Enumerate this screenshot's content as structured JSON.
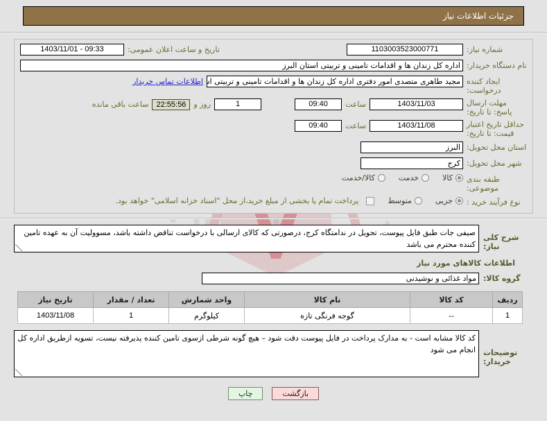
{
  "header": {
    "title": "جزئیات اطلاعات نیاز"
  },
  "fields": {
    "need_number": {
      "label": "شماره نیاز:",
      "value": "1103003523000771"
    },
    "public_announce": {
      "label": "تاریخ و ساعت اعلان عمومی:",
      "value": "1403/11/01 - 09:33"
    },
    "buyer_org": {
      "label": "نام دستگاه خریدار:",
      "value": "اداره کل زندان ها و اقدامات تامینی و تربیتی استان البرز"
    },
    "creator": {
      "label": "ایجاد کننده درخواست:",
      "value": "مجید طاهری متصدی امور دفتری اداره کل زندان ها و اقدامات تامینی و تربیتی اس",
      "link": "اطلاعات تماس خریدار"
    },
    "reply_deadline": {
      "label": "مهلت ارسال پاسخ: تا تاریخ:",
      "date": "1403/11/03",
      "time_label": "ساعت",
      "time": "09:40",
      "days": "1",
      "days_label": "روز و",
      "countdown": "22:55:56",
      "remaining_label": "ساعت باقی مانده"
    },
    "price_validity": {
      "label": "حداقل تاریخ اعتبار قیمت: تا تاریخ:",
      "date": "1403/11/08",
      "time_label": "ساعت",
      "time": "09:40"
    },
    "province": {
      "label": "استان محل تحویل:",
      "value": "البرز"
    },
    "city": {
      "label": "شهر محل تحویل:",
      "value": "کرج"
    },
    "classification": {
      "label": "طبقه بندی موضوعی:",
      "options": [
        {
          "label": "کالا",
          "selected": true
        },
        {
          "label": "خدمت",
          "selected": false
        },
        {
          "label": "کالا/خدمت",
          "selected": false
        }
      ]
    },
    "purchase_type": {
      "label": "نوع فرآیند خرید :",
      "options": [
        {
          "label": "جزیی",
          "selected": true
        },
        {
          "label": "متوسط",
          "selected": false
        }
      ],
      "checkbox_label": "پرداخت تمام یا بخشی از مبلغ خرید،از محل \"اسناد خزانه اسلامی\" خواهد بود.",
      "checkbox_checked": false
    }
  },
  "description": {
    "label": "شرح کلی نیاز:",
    "value": "صیفی جات طبق فایل پیوست، تحویل در ندامتگاه کرج، درصورتی که کالای ارسالی با درخواست تناقض داشته باشد، مسوولیت آن به عهده تامین کننده محترم می باشد"
  },
  "goods_section": {
    "title": "اطلاعات کالاهای مورد نیاز",
    "group_label": "گروه کالا:",
    "group_value": "مواد غذائی و نوشیدنی",
    "columns": [
      "ردیف",
      "کد کالا",
      "نام کالا",
      "واحد شمارش",
      "تعداد / مقدار",
      "تاریخ نیاز"
    ],
    "rows": [
      {
        "radif": "1",
        "code": "--",
        "name": "گوجه فرنگی تازه",
        "unit": "کیلوگرم",
        "qty": "1",
        "need_date": "1403/11/08"
      }
    ]
  },
  "buyer_notes": {
    "label": "توضیحات خریدار:",
    "value": "کد کالا مشابه است - به مدارک پرداخت در فایل پیوست دقت شود – هیچ گونه شرطی ازسوی تامین کننده پذیرفته نیست، تسویه ازطریق اداره کل انجام می شود"
  },
  "footer": {
    "print_label": "چاپ",
    "back_label": "بازگشت"
  },
  "watermark": {
    "text": "ridlandee.net"
  },
  "colors": {
    "header_bg": "#8f7247",
    "label": "#6b6b33",
    "link": "#2222cc",
    "print_bg": "#e3f5e3",
    "back_bg": "#fadbdb"
  }
}
